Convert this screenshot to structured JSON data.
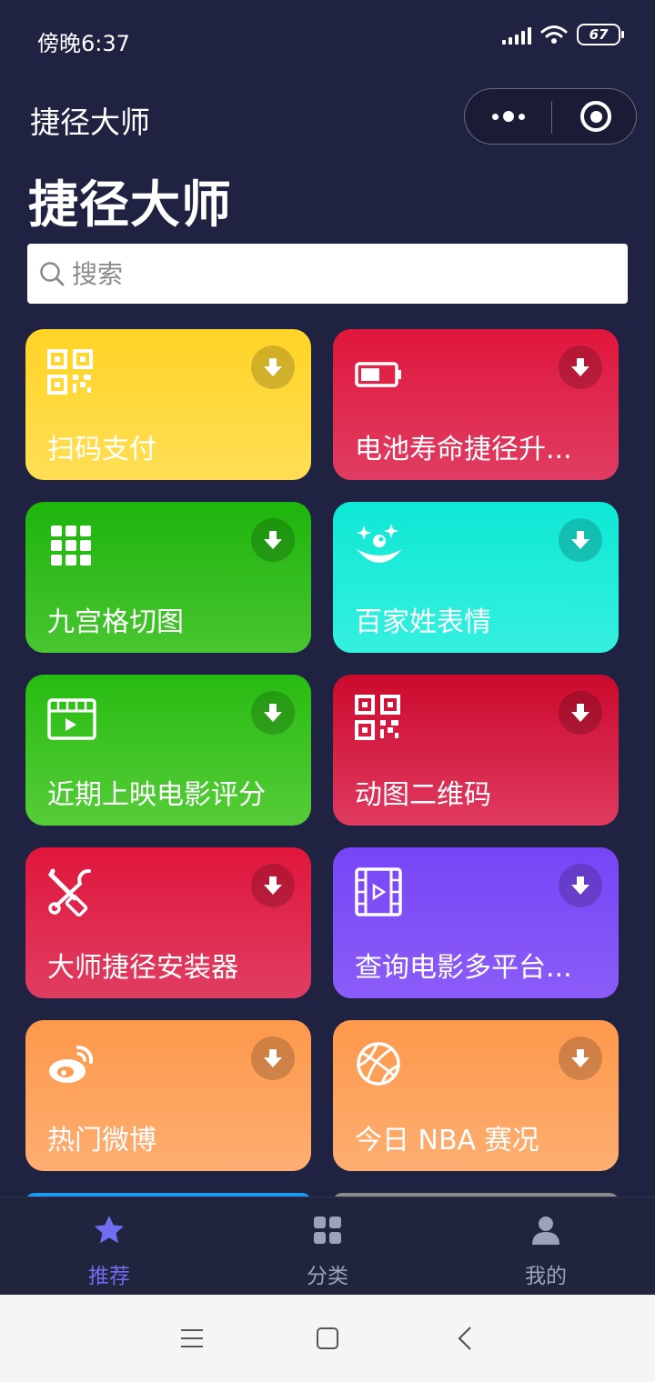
{
  "status": {
    "time": "傍晚6:37",
    "battery": "67"
  },
  "nav": {
    "title": "捷径大师"
  },
  "page": {
    "title": "捷径大师"
  },
  "search": {
    "placeholder": "搜索"
  },
  "cards": [
    {
      "label": "扫码支付",
      "icon": "qr-code-icon",
      "color": "#ffd426"
    },
    {
      "label": "电池寿命捷径升...",
      "icon": "battery-icon",
      "color": "#e0183e"
    },
    {
      "label": "九宫格切图",
      "icon": "grid-icon",
      "color": "#22b80f"
    },
    {
      "label": "百家姓表情",
      "icon": "smiley-icon",
      "color": "#12e8d3"
    },
    {
      "label": "近期上映电影评分",
      "icon": "film-clapper-icon",
      "color": "#2cc017"
    },
    {
      "label": "动图二维码",
      "icon": "qr-code-icon",
      "color": "#cc0a2e"
    },
    {
      "label": "大师捷径安装器",
      "icon": "tools-icon",
      "color": "#e0183e"
    },
    {
      "label": "查询电影多平台...",
      "icon": "film-strip-icon",
      "color": "#7b4cf6"
    },
    {
      "label": "热门微博",
      "icon": "weibo-icon",
      "color": "#fd9a4e"
    },
    {
      "label": "今日 NBA 赛况",
      "icon": "basketball-icon",
      "color": "#fd9a4e"
    }
  ],
  "tabs": [
    {
      "label": "推荐",
      "icon": "star-icon",
      "active": true
    },
    {
      "label": "分类",
      "icon": "category-icon",
      "active": false
    },
    {
      "label": "我的",
      "icon": "user-icon",
      "active": false
    }
  ]
}
